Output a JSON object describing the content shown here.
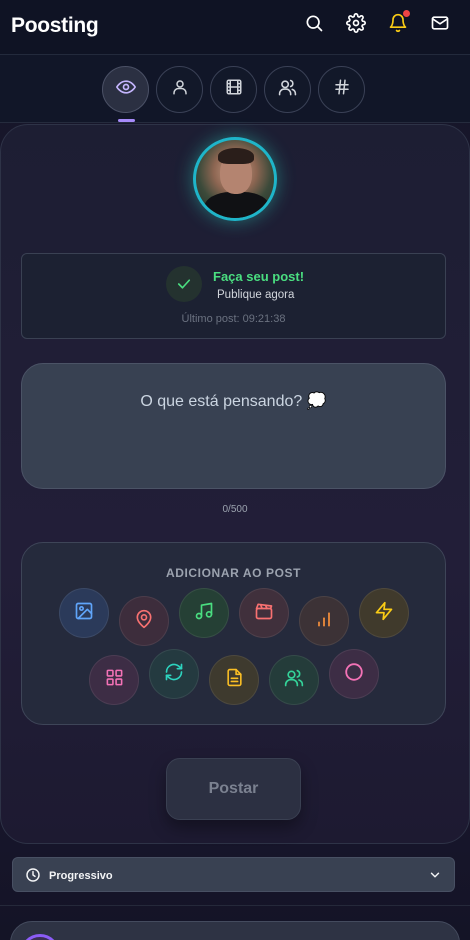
{
  "app": {
    "title": "Poosting"
  },
  "header_icons": [
    "search-icon",
    "gear-icon",
    "bell-icon",
    "mail-icon"
  ],
  "tabs": [
    {
      "icon": "eye-icon",
      "active": true
    },
    {
      "icon": "user-icon",
      "active": false
    },
    {
      "icon": "film-icon",
      "active": false
    },
    {
      "icon": "users-icon",
      "active": false
    },
    {
      "icon": "hash-icon",
      "active": false
    }
  ],
  "status": {
    "title": "Faça seu post!",
    "subtitle": "Publique agora",
    "last_post": "Último post: 09:21:38"
  },
  "composer": {
    "placeholder": "O que está pensando? 💭",
    "char_count": "0/500"
  },
  "add_panel": {
    "title": "ADICIONAR AO POST",
    "buttons": [
      {
        "icon": "image-icon",
        "color": "#60a5fa"
      },
      {
        "icon": "map-pin-icon",
        "color": "#f87171"
      },
      {
        "icon": "music-icon",
        "color": "#4ade80"
      },
      {
        "icon": "clapperboard-icon",
        "color": "#f87171"
      },
      {
        "icon": "bar-chart-icon",
        "color": "#fb923c"
      },
      {
        "icon": "zap-icon",
        "color": "#facc15"
      },
      {
        "icon": "grid-icon",
        "color": "#f472b6"
      },
      {
        "icon": "refresh-icon",
        "color": "#2dd4bf"
      },
      {
        "icon": "file-text-icon",
        "color": "#fbbf24"
      },
      {
        "icon": "users-icon",
        "color": "#34d399"
      },
      {
        "icon": "circle-icon",
        "color": "#f472b6"
      }
    ]
  },
  "post_button": {
    "label": "Postar"
  },
  "mode_dropdown": {
    "selected": "Progressivo"
  },
  "colors": {
    "accent": "#a78bfa",
    "success": "#4ade80",
    "avatar_ring": "#1fb5c9",
    "notification": "#ef4444"
  }
}
